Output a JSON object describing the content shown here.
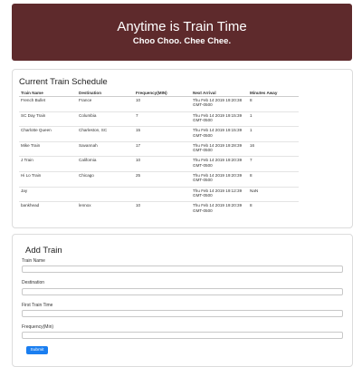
{
  "banner": {
    "title": "Anytime is Train Time",
    "subtitle": "Choo Choo. Chee Chee."
  },
  "schedule": {
    "title": "Current Train Schedule",
    "columns": [
      "Train Name",
      "Destination",
      "Frequency(MIN)",
      "Next Arrival",
      "Minutes Away"
    ],
    "rows": [
      {
        "name": "French Bullet",
        "destination": "France",
        "frequency": "10",
        "next_arrival": "Thu Feb 14 2019 19:20:38 GMT-0500",
        "minutes_away": "8"
      },
      {
        "name": "SC Day Train",
        "destination": "Columbia",
        "frequency": "7",
        "next_arrival": "Thu Feb 14 2019 19:15:39 GMT-0500",
        "minutes_away": "1"
      },
      {
        "name": "Charlotte Queen",
        "destination": "Charleston, SC",
        "frequency": "15",
        "next_arrival": "Thu Feb 14 2019 19:15:39 GMT-0500",
        "minutes_away": "1"
      },
      {
        "name": "Mike Train",
        "destination": "Savannah",
        "frequency": "17",
        "next_arrival": "Thu Feb 14 2019 19:28:39 GMT-0500",
        "minutes_away": "16"
      },
      {
        "name": "J Train",
        "destination": "California",
        "frequency": "10",
        "next_arrival": "Thu Feb 14 2019 19:20:39 GMT-0500",
        "minutes_away": "7"
      },
      {
        "name": "Hi Lo Train",
        "destination": "Chicago",
        "frequency": "25",
        "next_arrival": "Thu Feb 14 2019 19:20:39 GMT-0500",
        "minutes_away": "8"
      },
      {
        "name": "Jay",
        "destination": "",
        "frequency": "",
        "next_arrival": "Thu Feb 14 2019 19:12:39 GMT-0500",
        "minutes_away": "NaN"
      },
      {
        "name": "bankhead",
        "destination": "lennox",
        "frequency": "10",
        "next_arrival": "Thu Feb 14 2019 19:20:39 GMT-0500",
        "minutes_away": "8"
      }
    ]
  },
  "add_train": {
    "title": "Add Train",
    "fields": [
      {
        "label": "Train Name",
        "value": ""
      },
      {
        "label": "Destination",
        "value": ""
      },
      {
        "label": "First Train Time",
        "value": ""
      },
      {
        "label": "Frequency(Min)",
        "value": ""
      }
    ],
    "submit_label": "Submit"
  },
  "colors": {
    "banner_bg": "#5e2a2c",
    "submit_bg": "#1a7ef0"
  }
}
